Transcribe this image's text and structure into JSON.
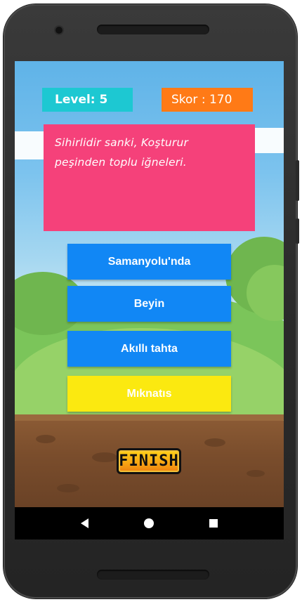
{
  "header": {
    "level_text": "Level: 5",
    "score_text": "Skor : 170"
  },
  "question": {
    "line1": "Sihirlidir sanki, Koşturur",
    "line2": "peşinden toplu iğneleri."
  },
  "answers": [
    {
      "label": "Samanyolu'nda"
    },
    {
      "label": "Beyin"
    },
    {
      "label": "Akıllı tahta"
    },
    {
      "label": "Mıknatıs"
    }
  ],
  "finish_label": "FINISH",
  "colors": {
    "level_bg": "#1dc8d2",
    "score_bg": "#ff7a16",
    "question_bg": "#f5417a",
    "answer_bg": "#1187f5",
    "answer_highlight_bg": "#fbe910"
  },
  "nav": {
    "back_icon": "back-triangle-icon",
    "home_icon": "home-circle-icon",
    "recent_icon": "recent-square-icon"
  }
}
